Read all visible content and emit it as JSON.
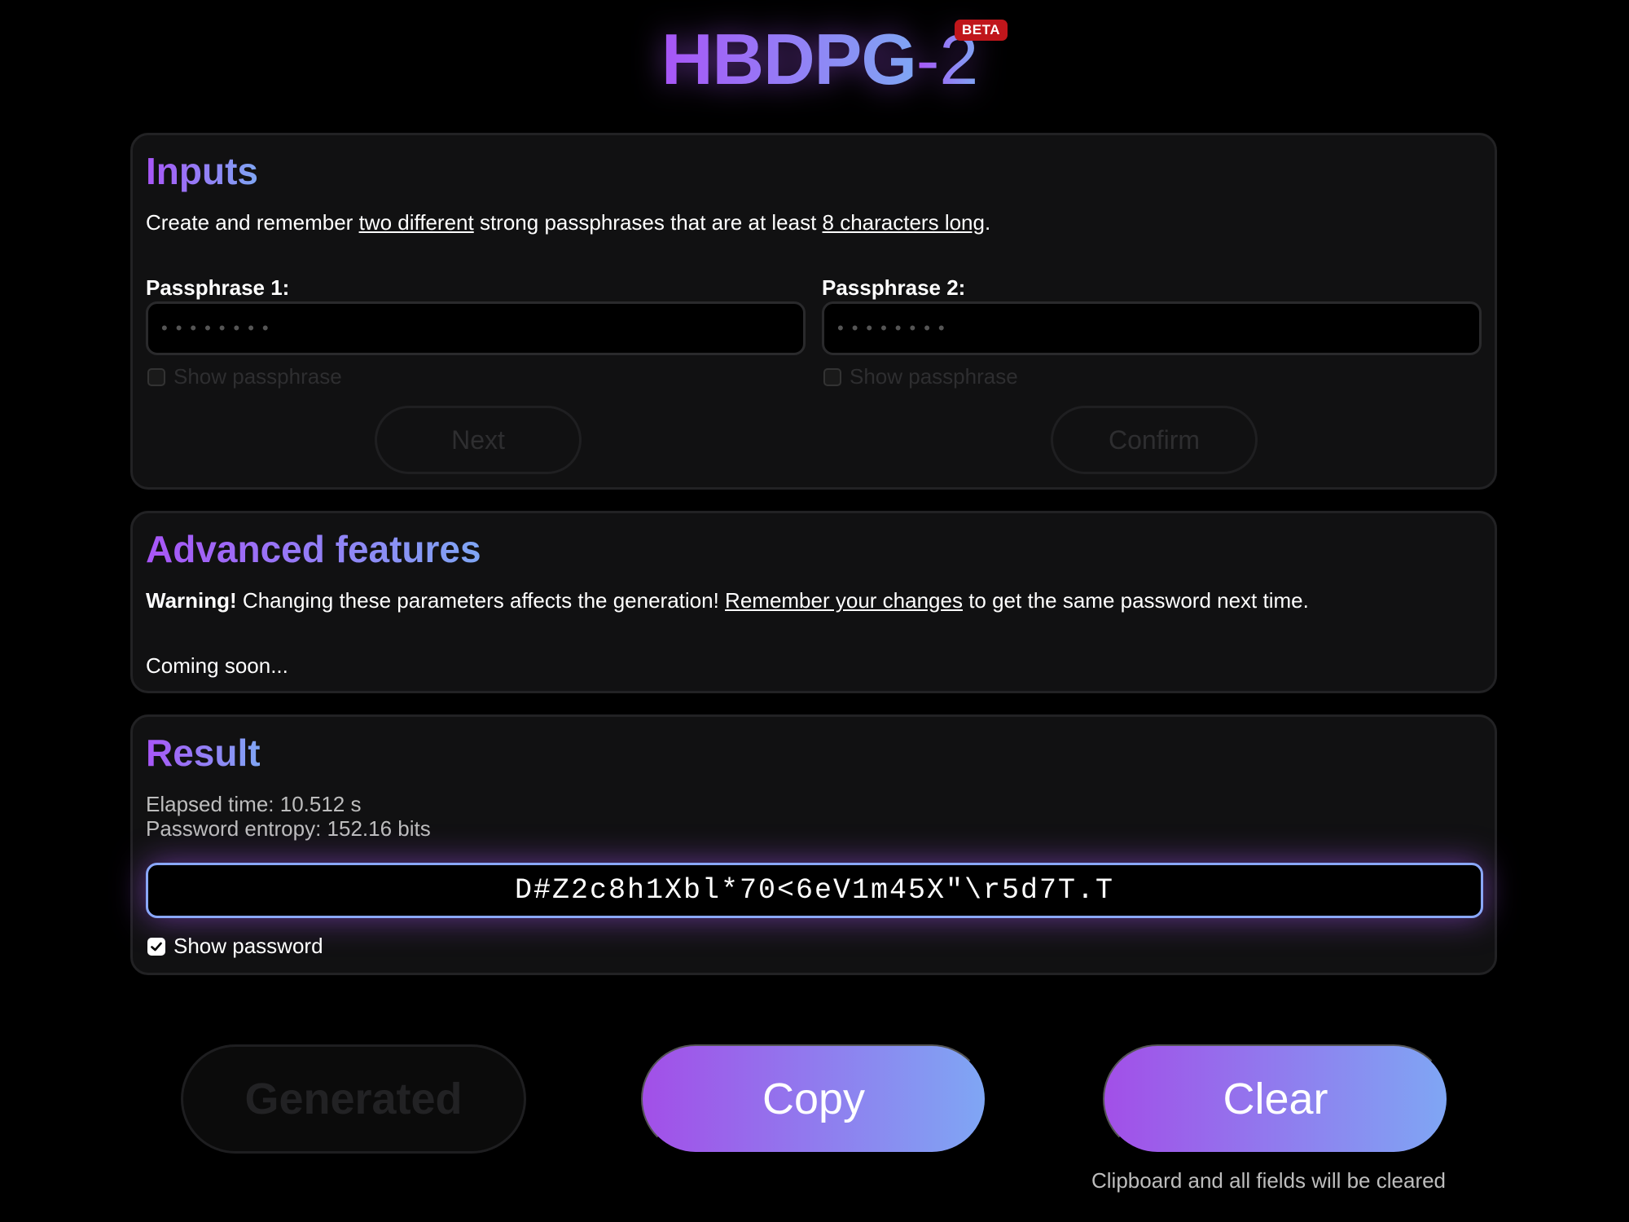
{
  "header": {
    "logo_main": "HBDPG",
    "logo_suffix": "-2",
    "badge": "BETA"
  },
  "inputs": {
    "title": "Inputs",
    "desc_before": "Create and remember ",
    "desc_emph1": "two different",
    "desc_mid": " strong passphrases that are at least ",
    "desc_emph2": "8 characters long",
    "desc_after": ".",
    "pass1_label": "Passphrase 1:",
    "pass1_value": "••••••••",
    "pass1_show": "Show passphrase",
    "next_button": "Next",
    "pass2_label": "Passphrase 2:",
    "pass2_value": "••••••••",
    "pass2_show": "Show passphrase",
    "confirm_button": "Confirm"
  },
  "advanced": {
    "title": "Advanced features",
    "warning_bold": "Warning!",
    "warning_text": " Changing these parameters affects the generation! ",
    "warning_link": "Remember your changes",
    "warning_after": " to get the same password next time.",
    "coming_soon": "Coming soon..."
  },
  "result": {
    "title": "Result",
    "elapsed": "Elapsed time: 10.512 s",
    "entropy": "Password entropy: 152.16 bits",
    "password": "D#Z2c8h1Xbl*70<6eV1m45X\"\\r5d7T.T",
    "show_password": "Show password",
    "show_password_checked": true
  },
  "actions": {
    "generated_button": "Generated",
    "copy_button": "Copy",
    "clear_button": "Clear",
    "clear_hint": "Clipboard and all fields will be cleared"
  },
  "colors": {
    "accent_start": "#a855f7",
    "accent_end": "#7fa6f4",
    "beta_badge": "#c0161b",
    "result_border": "#8aa8ff",
    "background": "#000000"
  }
}
